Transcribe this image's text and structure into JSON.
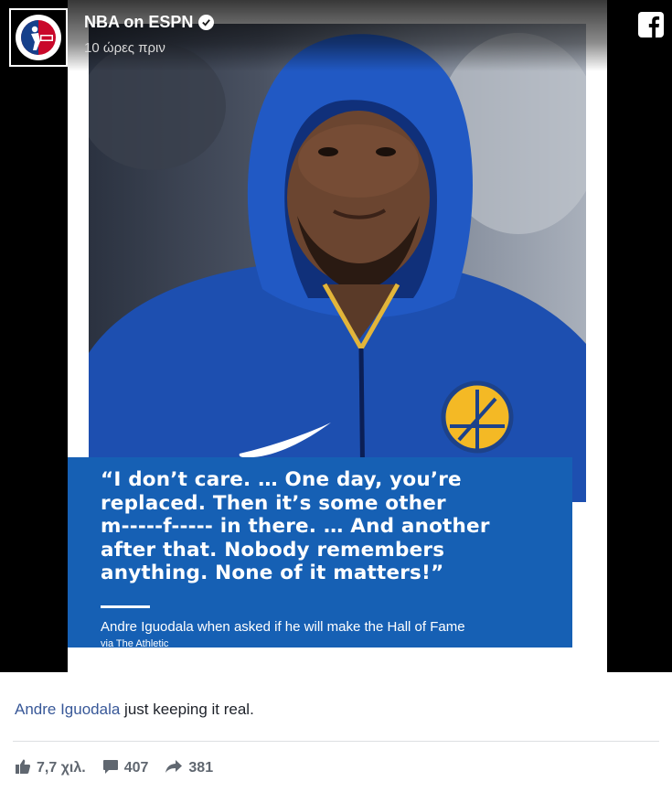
{
  "post": {
    "page_name": "NBA on ESPN",
    "timestamp": "10 ώρες πριν",
    "avatar_logo_text": "NBA ESPN",
    "quote_card": {
      "quote": "“I don’t care. … One day, you’re\nreplaced. Then it’s some other\nm-----f----- in there. … And another\nafter that. Nobody remembers\nanything. None of it matters!”",
      "attribution": "Andre Iguodala when asked if he will make the Hall of Fame",
      "source": "via The Athletic"
    },
    "caption": {
      "tag": "Andre Iguodala",
      "text": " just keeping it real."
    },
    "stats": {
      "likes": "7,7 χιλ.",
      "comments": "407",
      "shares": "381"
    }
  },
  "icons": {
    "platform": "facebook-icon",
    "verified": "verified-badge-icon",
    "like": "thumbs-up-icon",
    "comment": "comment-icon",
    "share": "share-arrow-icon"
  },
  "colors": {
    "quote_box": "#1660b4",
    "link": "#385898",
    "stat_text": "#606770",
    "hoodie": "#1d4fb0"
  }
}
